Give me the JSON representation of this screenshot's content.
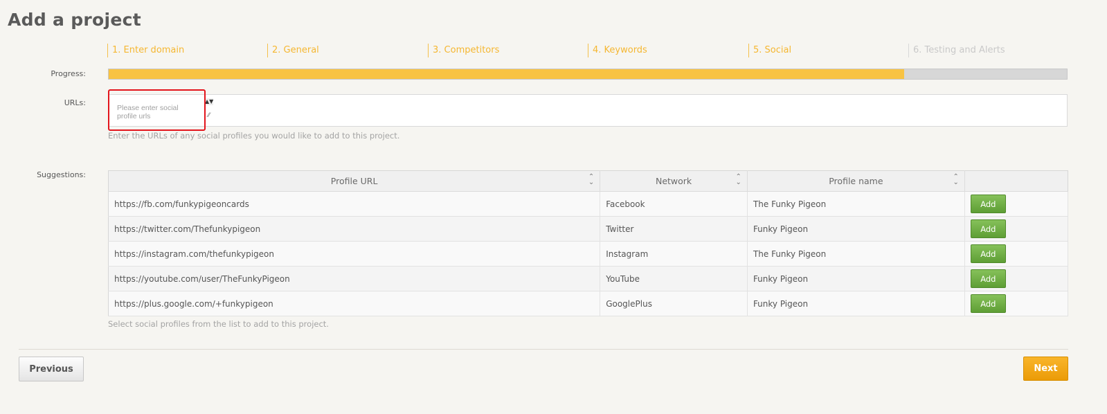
{
  "page": {
    "title": "Add a project"
  },
  "steps": [
    {
      "label": "1. Enter domain",
      "state": "done"
    },
    {
      "label": "2. General",
      "state": "done"
    },
    {
      "label": "3. Competitors",
      "state": "done"
    },
    {
      "label": "4. Keywords",
      "state": "done"
    },
    {
      "label": "5. Social",
      "state": "active"
    },
    {
      "label": "6. Testing and Alerts",
      "state": "pending"
    }
  ],
  "progress": {
    "label": "Progress:",
    "percent": 83
  },
  "urls": {
    "label": "URLs:",
    "placeholder": "Please enter social profile urls",
    "value": "",
    "help": "Enter the URLs of any social profiles you would like to add to this project."
  },
  "suggestions": {
    "label": "Suggestions:",
    "columns": [
      "Profile URL",
      "Network",
      "Profile name",
      ""
    ],
    "add_label": "Add",
    "rows": [
      {
        "url": "https://fb.com/funkypigeoncards",
        "network": "Facebook",
        "name": "The Funky Pigeon"
      },
      {
        "url": "https://twitter.com/Thefunkypigeon",
        "network": "Twitter",
        "name": "Funky Pigeon"
      },
      {
        "url": "https://instagram.com/thefunkypigeon",
        "network": "Instagram",
        "name": "The Funky Pigeon"
      },
      {
        "url": "https://youtube.com/user/TheFunkyPigeon",
        "network": "YouTube",
        "name": "Funky Pigeon"
      },
      {
        "url": "https://plus.google.com/+funkypigeon",
        "network": "GooglePlus",
        "name": "Funky Pigeon"
      }
    ],
    "help": "Select social profiles from the list to add to this project."
  },
  "nav": {
    "previous_label": "Previous",
    "next_label": "Next"
  },
  "colors": {
    "accent": "#f8c343",
    "add_button": "#6aaa3e",
    "next_button": "#f0a30f",
    "highlight": "#e3141b"
  }
}
